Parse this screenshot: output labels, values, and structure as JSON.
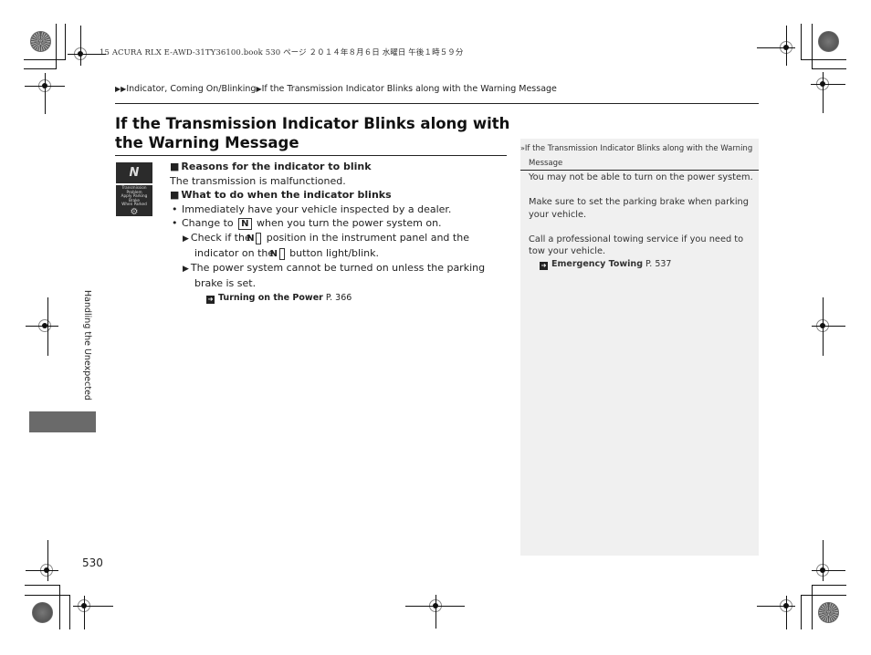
{
  "print_header": "15 ACURA RLX E-AWD-31TY36100.book  530 ページ  ２０１４年８月６日  水曜日  午後１時５９分",
  "breadcrumb": {
    "prefix_icon": "double-triangle-right-icon",
    "items": [
      "Indicator, Coming On/Blinking",
      "If the Transmission Indicator Blinks along with the Warning Message"
    ],
    "separator_icon": "triangle-right-icon"
  },
  "title": "If the Transmission Indicator Blinks along with the Warning Message",
  "indicator_images": {
    "indicator_glyph": "N",
    "warning_message": [
      "Transmission",
      "Problem",
      "Apply Parking Brake",
      "When Parked"
    ],
    "warning_icon": "gear-warning-icon"
  },
  "main": {
    "section1_heading": "Reasons for the indicator to blink",
    "section1_text": "The transmission is malfunctioned.",
    "section2_heading": "What to do when the indicator blinks",
    "bullet1": "Immediately have your vehicle inspected by a dealer.",
    "bullet2_pre": "Change to",
    "bullet2_key": "N",
    "bullet2_post": "when you turn the power system on.",
    "sub1_pre": "Check if the",
    "sub1_key1": "N",
    "sub1_mid": "position in the instrument panel and the indicator on the",
    "sub1_key2": "N",
    "sub1_post": "button light/blink.",
    "sub2": "The power system cannot be turned on unless the parking brake is set.",
    "ref_label": "Turning on the Power",
    "ref_page": "P. 366"
  },
  "sidebar": {
    "heading_line1": "If the Transmission Indicator Blinks along with the Warning",
    "heading_line2": "Message",
    "p1": "You may not be able to turn on the power system.",
    "p2": "Make sure to set the parking brake when parking your vehicle.",
    "p3": "Call a professional towing service if you need to tow your vehicle.",
    "ref_label": "Emergency Towing",
    "ref_page": "P. 537"
  },
  "section_tab": "Handling the Unexpected",
  "page_number": "530",
  "colors": {
    "sidebar_bg": "#f0f0f0",
    "tab_gray": "#6a6a6a",
    "text": "#222222"
  }
}
